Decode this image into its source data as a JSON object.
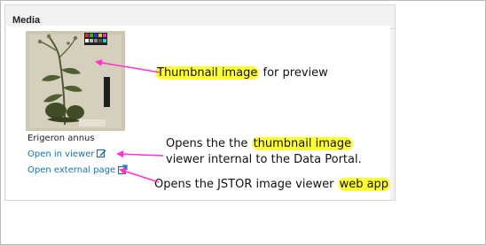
{
  "panel": {
    "title": "Media"
  },
  "media": {
    "specimen_name": "Erigeron annus",
    "open_viewer_label": "Open in viewer",
    "open_external_label": "Open external page"
  },
  "annotations": {
    "thumbnail_highlight": "Thumbnail image",
    "thumbnail_rest": " for preview",
    "viewer_line1_pre": "Opens the the ",
    "viewer_line1_highlight": "thumbnail image",
    "viewer_line2": "viewer internal to the Data Portal.",
    "external_pre": "Opens the JSTOR image viewer ",
    "external_highlight": "web app"
  },
  "colors": {
    "link": "#1a6fa8",
    "highlight": "#ffff33",
    "arrow": "#ff33cc"
  },
  "icons": {
    "viewer": "edit-icon",
    "external": "external-link-icon"
  }
}
